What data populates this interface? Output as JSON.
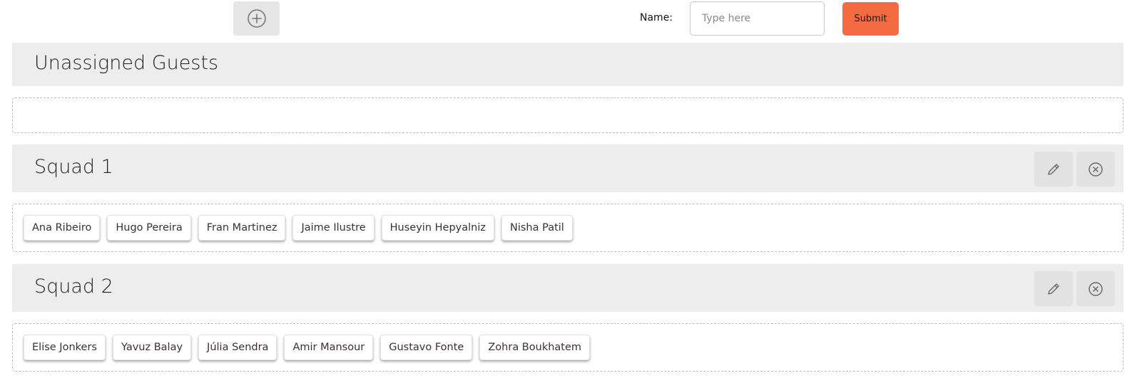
{
  "toolbar": {
    "add_group_icon": "plus-circle-icon",
    "name_label": "Name:",
    "name_input_value": "",
    "name_input_placeholder": "Type here",
    "submit_label": "Submit",
    "submit_color": "#f46a41"
  },
  "unassigned": {
    "title": "Unassigned Guests",
    "guests": []
  },
  "groups": [
    {
      "title": "Squad 1",
      "edit_icon": "pencil-icon",
      "delete_icon": "close-circle-icon",
      "guests": [
        "Ana Ribeiro",
        "Hugo Pereira",
        "Fran Martinez",
        "Jaime Ilustre",
        "Huseyin Hepyalniz",
        "Nisha Patil"
      ]
    },
    {
      "title": "Squad 2",
      "edit_icon": "pencil-icon",
      "delete_icon": "close-circle-icon",
      "guests": [
        "Elise Jonkers",
        "Yavuz Balay",
        "Júlia Sendra",
        "Amir Mansour",
        "Gustavo Fonte",
        "Zohra Boukhatem"
      ]
    }
  ]
}
